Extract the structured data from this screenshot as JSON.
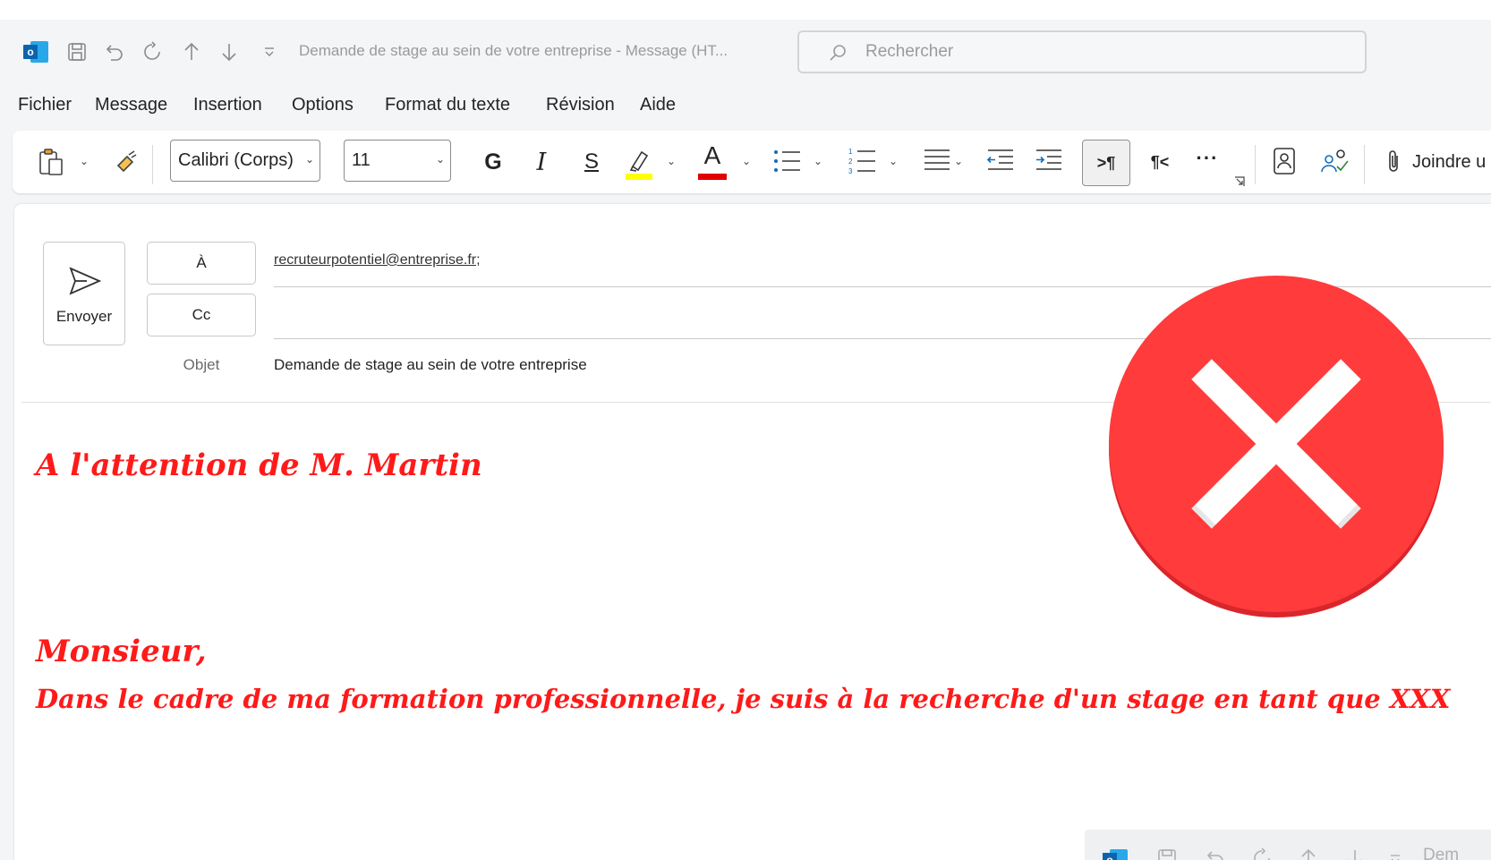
{
  "titlebar": {
    "title": "Demande de stage au sein de votre entreprise  -  Message (HT...",
    "search_placeholder": "Rechercher",
    "icons": [
      "outlook-logo",
      "save-icon",
      "undo-icon",
      "redo-icon",
      "arrow-up-icon",
      "arrow-down-icon",
      "customize-chevron-icon",
      "search-icon"
    ]
  },
  "tabs": [
    {
      "label": "Fichier"
    },
    {
      "label": "Message"
    },
    {
      "label": "Insertion"
    },
    {
      "label": "Options"
    },
    {
      "label": "Format du texte"
    },
    {
      "label": "Révision"
    },
    {
      "label": "Aide"
    }
  ],
  "ribbon": {
    "font_name": "Calibri (Corps)",
    "font_size": "11",
    "bold_label": "G",
    "italic_label": "I",
    "underline_label": "S",
    "font_color_label": "A",
    "ltr_label": ">¶",
    "rtl_label": "¶<",
    "more_label": "···",
    "attach_label": "Joindre u",
    "highlight_color": "#ffff00",
    "font_color": "#e00000"
  },
  "compose": {
    "send_label": "Envoyer",
    "to_label": "À",
    "cc_label": "Cc",
    "to_value": "recruteurpotentiel@entreprise.fr;",
    "subject_label": "Objet",
    "subject_value": "Demande de stage au sein de votre entreprise"
  },
  "body": {
    "line1": "A l'attention de M. Martin",
    "line2": "Monsieur,",
    "line3": "Dans le cadre de ma formation professionnelle, je suis à la recherche d'un stage en tant que XXX",
    "text_color": "#ff1a1a"
  },
  "overlay": {
    "error_icon": "red-x-icon",
    "error_color": "#ff3b3b"
  },
  "mini_window": {
    "title_fragment": "Dem"
  }
}
